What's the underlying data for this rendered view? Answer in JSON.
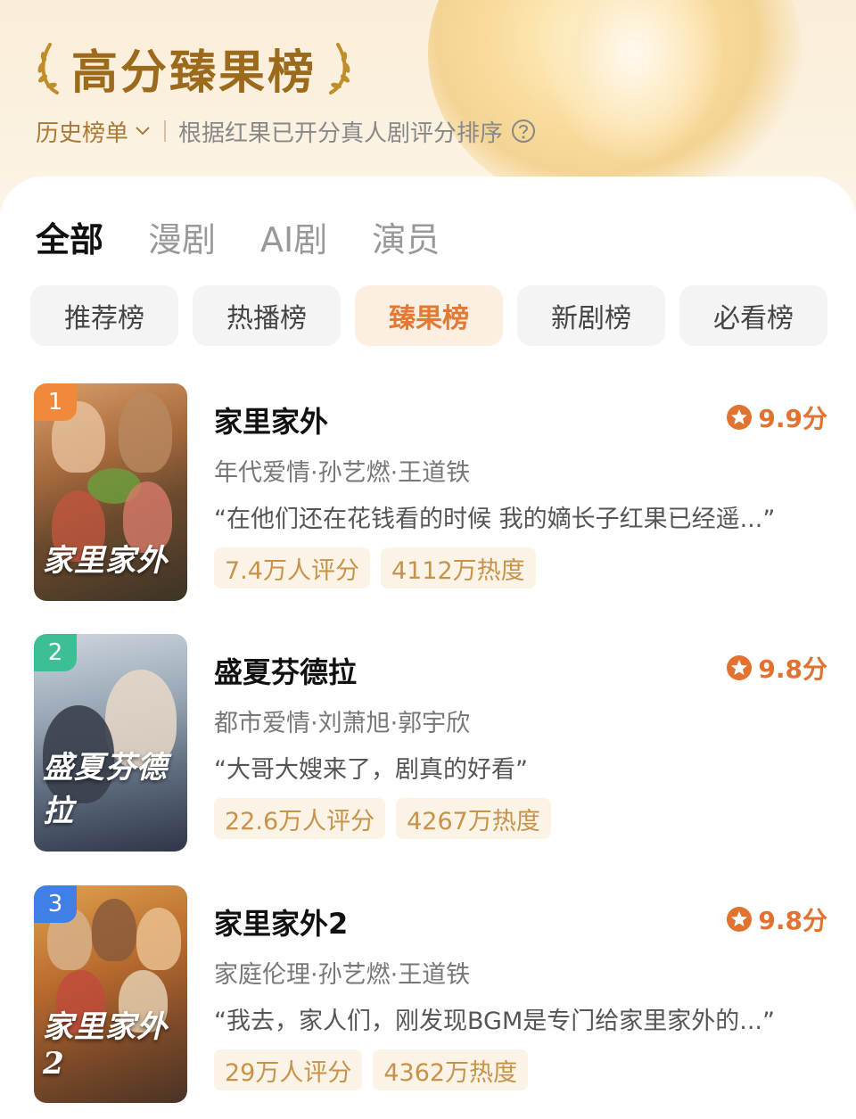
{
  "header": {
    "title": "高分臻果榜",
    "history_label": "历史榜单",
    "rule_text": "根据红果已开分真人剧评分排序"
  },
  "tabs": [
    {
      "label": "全部",
      "active": true
    },
    {
      "label": "漫剧",
      "active": false
    },
    {
      "label": "AI剧",
      "active": false
    },
    {
      "label": "演员",
      "active": false
    }
  ],
  "chips": [
    {
      "label": "推荐榜",
      "active": false
    },
    {
      "label": "热播榜",
      "active": false
    },
    {
      "label": "臻果榜",
      "active": true
    },
    {
      "label": "新剧榜",
      "active": false
    },
    {
      "label": "必看榜",
      "active": false
    }
  ],
  "items": [
    {
      "rank": "1",
      "rank_color": "#f08a3a",
      "name": "家里家外",
      "score": "9.9分",
      "meta": "年代爱情·孙艺燃·王道铁",
      "quote": "“在他们还在花钱看的时候 我的嫡长子红果已经遥...”",
      "ratings": "7.4万人评分",
      "heat": "4112万热度",
      "poster_text": "家里家外"
    },
    {
      "rank": "2",
      "rank_color": "#3dbf95",
      "name": "盛夏芬德拉",
      "score": "9.8分",
      "meta": "都市爱情·刘萧旭·郭宇欣",
      "quote": "“大哥大嫂来了，剧真的好看”",
      "ratings": "22.6万人评分",
      "heat": "4267万热度",
      "poster_text": "盛夏芬德拉"
    },
    {
      "rank": "3",
      "rank_color": "#3f7fe6",
      "name": "家里家外2",
      "score": "9.8分",
      "meta": "家庭伦理·孙艺燃·王道铁",
      "quote": "“我去，家人们，刚发现BGM是专门给家里家外的...”",
      "ratings": "29万人评分",
      "heat": "4362万热度",
      "poster_text": "家里家外2"
    }
  ],
  "colors": {
    "accent": "#e2722f",
    "title_gold": "#9b6a1c",
    "badge_bg": "#fbf3e6"
  }
}
